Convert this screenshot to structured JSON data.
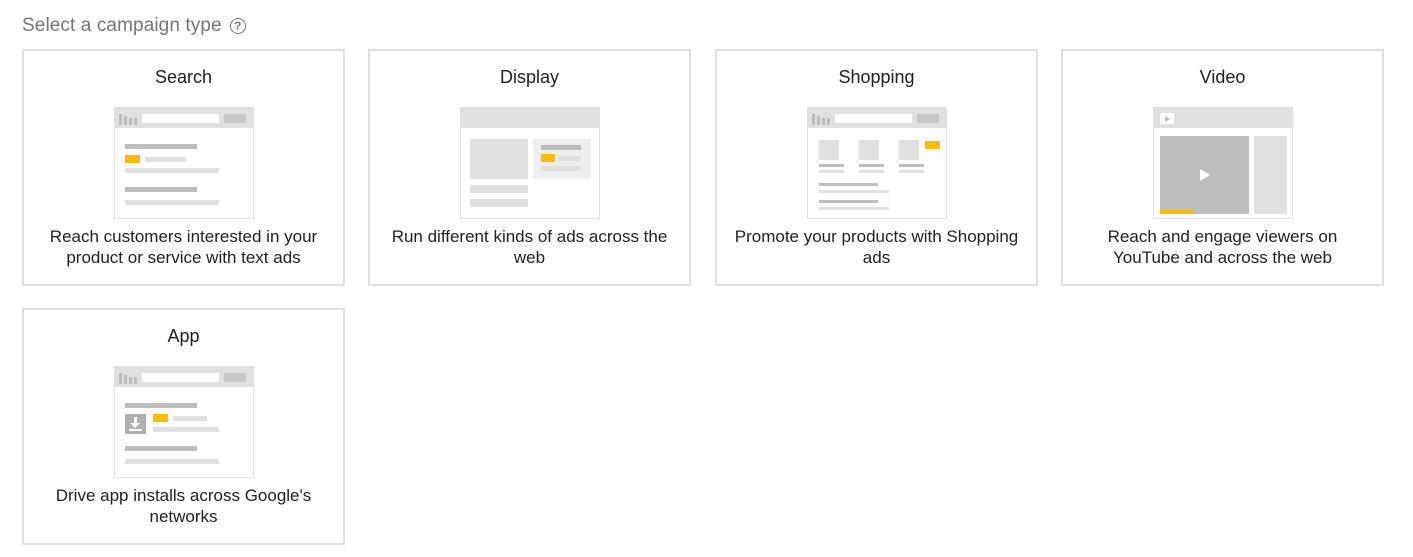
{
  "header": {
    "title": "Select a campaign type",
    "help_icon": "question-circle-icon",
    "help_glyph": "?"
  },
  "campaign_types": [
    {
      "title": "Search",
      "description": "Reach customers interested in your product or service with text ads",
      "illustration": "search-ad-illustration"
    },
    {
      "title": "Display",
      "description": "Run different kinds of ads across the web",
      "illustration": "display-ad-illustration"
    },
    {
      "title": "Shopping",
      "description": "Promote your products with Shopping ads",
      "illustration": "shopping-ad-illustration"
    },
    {
      "title": "Video",
      "description": "Reach and engage viewers on YouTube and across the web",
      "illustration": "video-ad-illustration"
    },
    {
      "title": "App",
      "description": "Drive app installs across Google's networks",
      "illustration": "app-ad-illustration"
    }
  ],
  "colors": {
    "accent": "#fbbc04",
    "border": "#e0e0e0",
    "illustration_gray": "#bdbdbd",
    "header_text": "#757575"
  }
}
